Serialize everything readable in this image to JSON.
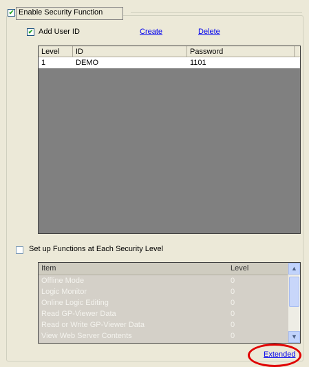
{
  "security": {
    "enable_label": "Enable Security Function",
    "enable_checked": true,
    "add_user_label": "Add User ID",
    "add_user_checked": true,
    "create_link": "Create",
    "delete_link": "Delete",
    "user_table": {
      "headers": [
        "Level",
        "ID",
        "Password"
      ],
      "rows": [
        {
          "level": "1",
          "id": "DEMO",
          "password": "1101"
        }
      ]
    },
    "setup_label": "Set up Functions at Each Security Level",
    "setup_checked": false,
    "functions_table": {
      "headers": [
        "Item",
        "Level"
      ],
      "rows": [
        {
          "item": "Offline Mode",
          "level": "0"
        },
        {
          "item": "Logic Monitor",
          "level": "0"
        },
        {
          "item": "Online Logic Editing",
          "level": "0"
        },
        {
          "item": "Read GP-Viewer Data",
          "level": "0"
        },
        {
          "item": "Read or Write GP-Viewer Data",
          "level": "0"
        },
        {
          "item": "View Web Server Contents",
          "level": "0"
        }
      ]
    },
    "extended_link": "Extended"
  },
  "colors": {
    "dialog_bg": "#ece9d8",
    "link": "#0000ee",
    "highlight_circle": "#e00000",
    "disabled_text": "#f4f3ee"
  },
  "icons": {
    "scroll_up": "scroll-up-arrow-icon",
    "scroll_down": "scroll-down-arrow-icon"
  }
}
